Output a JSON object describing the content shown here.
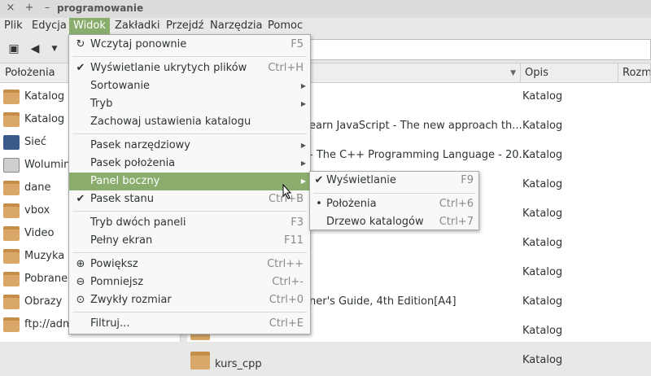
{
  "window": {
    "title": "programowanie",
    "close": "×",
    "maximize": "+",
    "minimize": "–"
  },
  "menubar": [
    "Plik",
    "Edycja",
    "Widok",
    "Zakładki",
    "Przejdź",
    "Narzędzia",
    "Pomoc"
  ],
  "sidebar": {
    "header": "Położenia",
    "items": [
      {
        "label": "Katalog d",
        "icon": "home-folder-icon"
      },
      {
        "label": "Katalog g",
        "icon": "folder-icon"
      },
      {
        "label": "Sieć",
        "icon": "network-icon"
      },
      {
        "label": "Wolumin",
        "icon": "drive-icon"
      },
      {
        "label": "dane",
        "icon": "folder-icon"
      },
      {
        "label": "vbox",
        "icon": "folder-icon"
      },
      {
        "label": "Video",
        "icon": "folder-icon"
      },
      {
        "label": "Muzyka",
        "icon": "folder-icon"
      },
      {
        "label": "Pobrane",
        "icon": "folder-icon"
      },
      {
        "label": "Obrazy",
        "icon": "folder-icon"
      },
      {
        "label": "ftp://adm",
        "icon": "folder-icon"
      }
    ]
  },
  "columns": {
    "sort_arrow": "▼",
    "desc": "Opis",
    "size": "Rozmi"
  },
  "files": [
    {
      "name": "",
      "desc": "Katalog"
    },
    {
      "name": "earn JavaScript - The new approach th...",
      "desc": "Katalog"
    },
    {
      "name": "- The C++ Programming Language - 20...",
      "desc": "Katalog"
    },
    {
      "name": "",
      "desc": "Katalog"
    },
    {
      "name": "",
      "desc": "Katalog"
    },
    {
      "name": "",
      "desc": "Katalog"
    },
    {
      "name": "",
      "desc": "Katalog"
    },
    {
      "name": "ner's Guide, 4th Edition[A4]",
      "desc": "Katalog"
    },
    {
      "name": "",
      "desc": "Katalog"
    },
    {
      "name": "kurs_cpp",
      "desc": "Katalog"
    }
  ],
  "view_menu": [
    {
      "label": "Wczytaj ponownie",
      "accel": "F5",
      "mark": "↻"
    },
    {
      "label": "Wyświetlanie ukrytych plików",
      "accel": "Ctrl+H",
      "mark": "✔"
    },
    {
      "label": "Sortowanie",
      "accel": "",
      "mark": "",
      "submenu": true
    },
    {
      "label": "Tryb",
      "accel": "",
      "mark": "",
      "submenu": true
    },
    {
      "label": "Zachowaj ustawienia katalogu",
      "accel": "",
      "mark": ""
    },
    {
      "label": "Pasek narzędziowy",
      "accel": "",
      "mark": "",
      "submenu": true
    },
    {
      "label": "Pasek położenia",
      "accel": "",
      "mark": "",
      "submenu": true
    },
    {
      "label": "Panel boczny",
      "accel": "",
      "mark": "",
      "submenu": true
    },
    {
      "label": "Pasek stanu",
      "accel": "Ctrl+B",
      "mark": "✔"
    },
    {
      "label": "Tryb dwóch paneli",
      "accel": "F3",
      "mark": ""
    },
    {
      "label": "Pełny ekran",
      "accel": "F11",
      "mark": ""
    },
    {
      "label": "Powiększ",
      "accel": "Ctrl++",
      "mark": "⊕"
    },
    {
      "label": "Pomniejsz",
      "accel": "Ctrl+-",
      "mark": "⊖"
    },
    {
      "label": "Zwykły rozmiar",
      "accel": "Ctrl+0",
      "mark": "⊙"
    },
    {
      "label": "Filtruj...",
      "accel": "Ctrl+E",
      "mark": ""
    }
  ],
  "submenu_side_panel": [
    {
      "label": "Wyświetlanie",
      "accel": "F9",
      "mark": "✔"
    },
    {
      "label": "Położenia",
      "accel": "Ctrl+6",
      "mark": "•"
    },
    {
      "label": "Drzewo katalogów",
      "accel": "Ctrl+7",
      "mark": ""
    }
  ],
  "colors": {
    "highlight": "#8aad6e",
    "folder": "#d9a868"
  }
}
